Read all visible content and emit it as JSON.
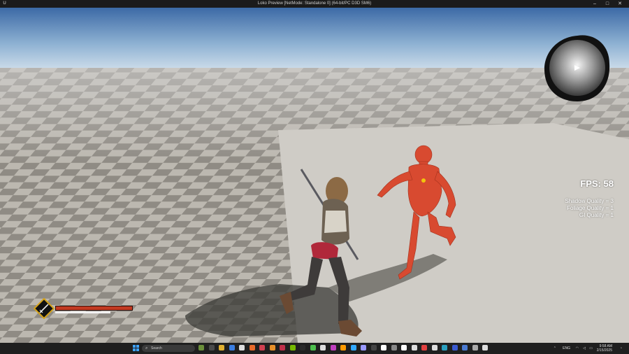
{
  "window": {
    "title": "Loko Preview [NetMode: Standalone 0]  (64-bit/PC D3D SM6)",
    "app_icon": "U",
    "controls": [
      "–",
      "□",
      "✕"
    ]
  },
  "hud": {
    "fps_label": "FPS: 58",
    "quality": [
      "Shadow Quality = 3",
      "Foliage Quality = 1",
      "GI Quality = 1"
    ],
    "health_fraction": 1.0,
    "stamina_fraction": 1.0,
    "weapon_icon": "sword-icon"
  },
  "taskbar": {
    "search_placeholder": "Search",
    "tray": {
      "language": "ENG",
      "time": "9:58 AM",
      "date": "2/15/2025"
    },
    "pinned_icons": [
      "widgets-icon",
      "task-view-icon",
      "file-explorer-icon",
      "chrome-icon",
      "app-icon",
      "app-icon",
      "app-icon",
      "app-icon",
      "app-icon",
      "nvidia-icon",
      "app-icon",
      "app-icon",
      "app-icon",
      "app-icon",
      "illustrator-icon",
      "photoshop-icon",
      "premiere-icon",
      "app-icon",
      "unreal-engine-icon",
      "app-icon",
      "unreal-engine-icon",
      "app-icon",
      "app-icon",
      "app-icon",
      "app-icon",
      "app-icon",
      "app-icon",
      "app-icon",
      "app-icon"
    ]
  },
  "colors": {
    "sky_top": "#3c6aa6",
    "sky_horizon": "#d8e4ee",
    "floor_light": "#bcb8b0",
    "floor_dark": "#8a867f",
    "platform": "#cfccc6",
    "mannequin": "#d84a30",
    "health": "#c23a22"
  }
}
